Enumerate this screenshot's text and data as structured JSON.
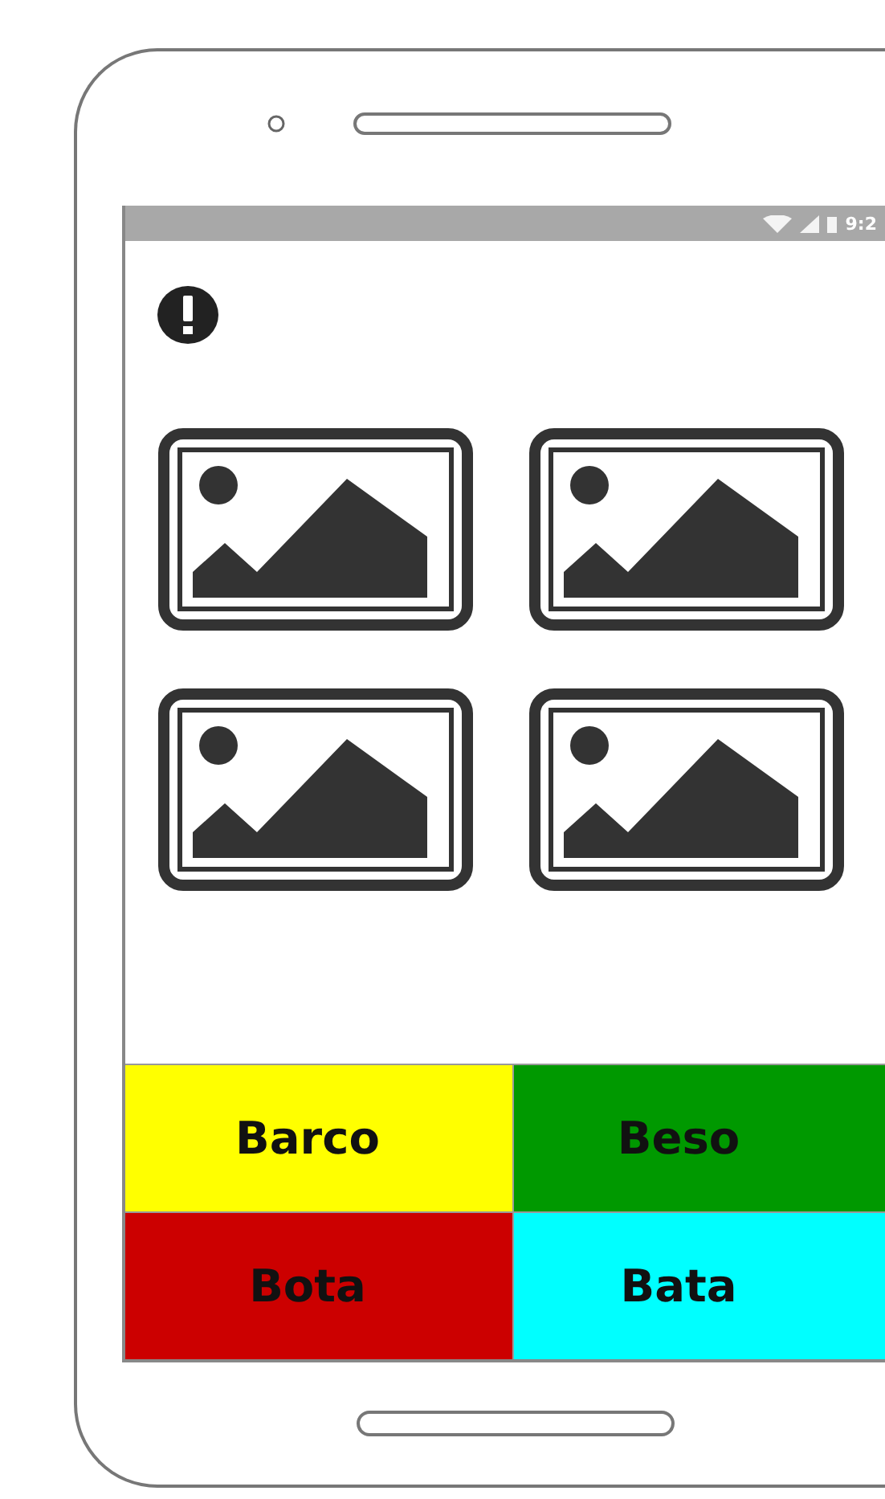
{
  "status_bar": {
    "time": "9:2"
  },
  "buttons": [
    {
      "label": "Barco",
      "color": "#ffff00"
    },
    {
      "label": "Beso",
      "color": "#009900"
    },
    {
      "label": "Bota",
      "color": "#cc0000"
    },
    {
      "label": "Bata",
      "color": "#00ffff"
    }
  ]
}
